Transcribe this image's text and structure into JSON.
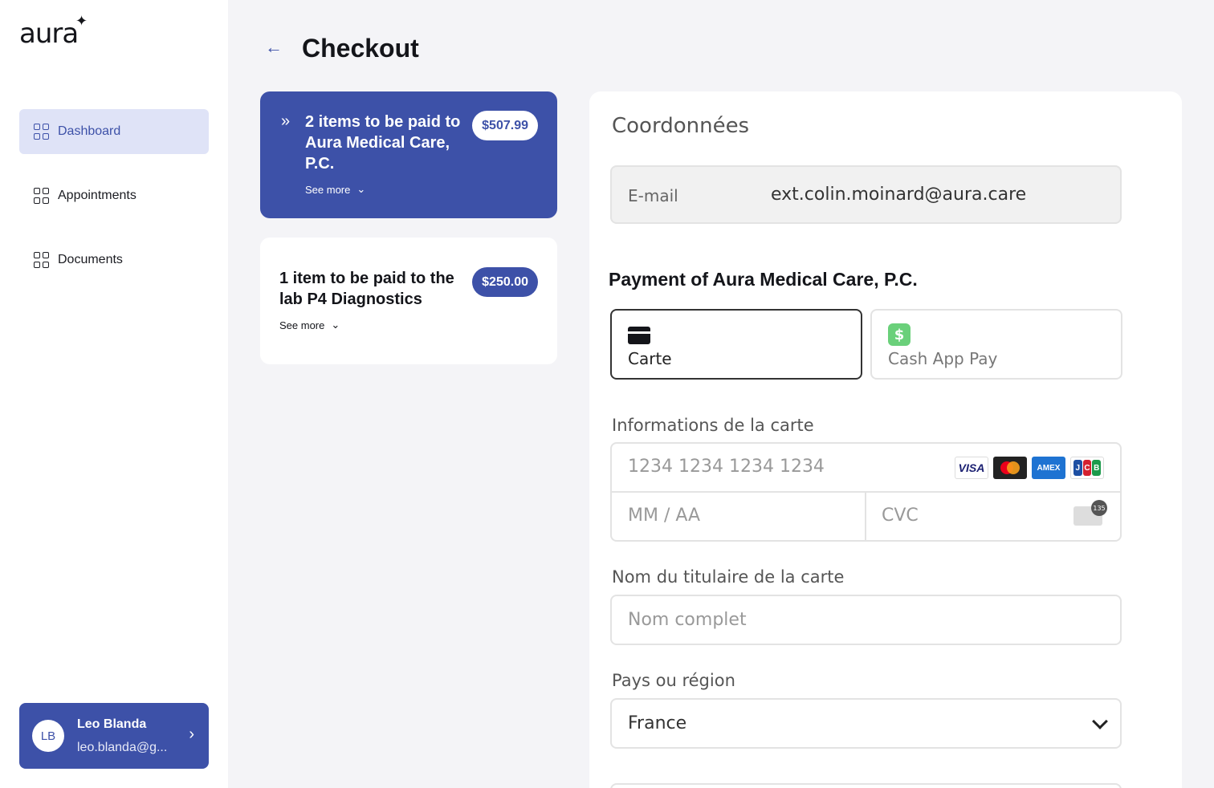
{
  "sidebar": {
    "logo": "aura",
    "nav": [
      {
        "label": "Dashboard",
        "active": true
      },
      {
        "label": "Appointments",
        "active": false
      },
      {
        "label": "Documents",
        "active": false
      }
    ],
    "user": {
      "initials": "LB",
      "name": "Leo Blanda",
      "email": "leo.blanda@g..."
    }
  },
  "header": {
    "title": "Checkout"
  },
  "items": [
    {
      "title": "2 items to be paid to Aura Medical Care, P.C.",
      "see_more": "See more",
      "amount": "$507.99"
    },
    {
      "title": "1 item to be paid to the lab P4 Diagnostics",
      "see_more": "See more",
      "amount": "$250.00"
    }
  ],
  "payment": {
    "section_title": "Coordonnées",
    "email_label": "E-mail",
    "email_value": "ext.colin.moinard@aura.care",
    "payment_title": "Payment of Aura Medical Care, P.C.",
    "methods": [
      {
        "label": "Carte",
        "selected": true
      },
      {
        "label": "Cash App Pay",
        "selected": false
      }
    ],
    "card_info_label": "Informations de la carte",
    "card_number_placeholder": "1234 1234 1234 1234",
    "expiry_placeholder": "MM / AA",
    "cvc_placeholder": "CVC",
    "cardholder_label": "Nom du titulaire de la carte",
    "cardholder_placeholder": "Nom complet",
    "country_label": "Pays ou région",
    "country_value": "France",
    "brands": [
      "VISA",
      "Mastercard",
      "AMEX",
      "JCB"
    ]
  },
  "colors": {
    "accent": "#3d51a8",
    "accent_light": "#dfe3f7",
    "background": "#f4f4f7"
  }
}
